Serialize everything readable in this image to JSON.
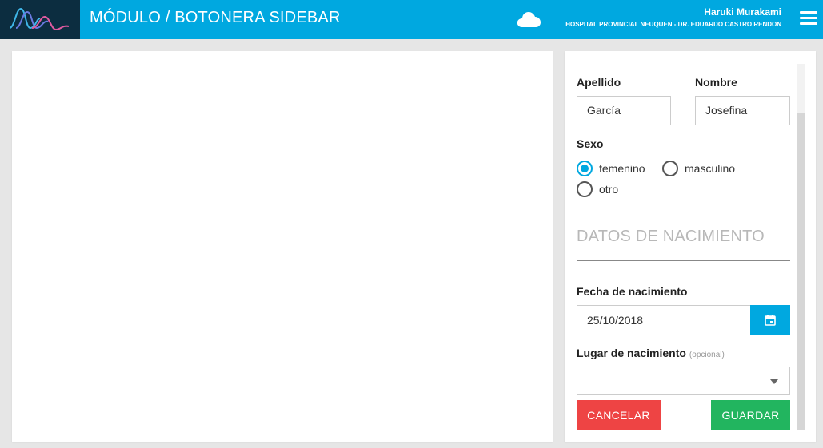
{
  "header": {
    "title": "MÓDULO / BOTONERA SIDEBAR",
    "user_name": "Haruki Murakami",
    "organization": "HOSPITAL PROVINCIAL NEUQUEN - DR. EDUARDO CASTRO RENDON",
    "logo_icon": "heartbeat-wave-icon",
    "cloud_icon": "cloud-icon",
    "menu_icon": "hamburger-menu-icon",
    "colors": {
      "bar": "#00a8e0",
      "logo_bg": "#0c2d40"
    }
  },
  "form": {
    "apellido": {
      "label": "Apellido",
      "value": "García"
    },
    "nombre": {
      "label": "Nombre",
      "value": "Josefina"
    },
    "sexo": {
      "label": "Sexo",
      "options": [
        {
          "label": "femenino",
          "selected": true
        },
        {
          "label": "masculino",
          "selected": false
        },
        {
          "label": "otro",
          "selected": false
        }
      ]
    },
    "section_title": "DATOS DE NACIMIENTO",
    "fecha": {
      "label": "Fecha de nacimiento",
      "value": "25/10/2018",
      "button_icon": "calendar-icon"
    },
    "lugar": {
      "label": "Lugar de nacimiento",
      "optional": "(opcional)",
      "value": ""
    },
    "buttons": {
      "cancel": "CANCELAR",
      "save": "GUARDAR"
    },
    "colors": {
      "accent": "#00a8e0",
      "cancel": "#ee4444",
      "save": "#22b55f"
    }
  }
}
